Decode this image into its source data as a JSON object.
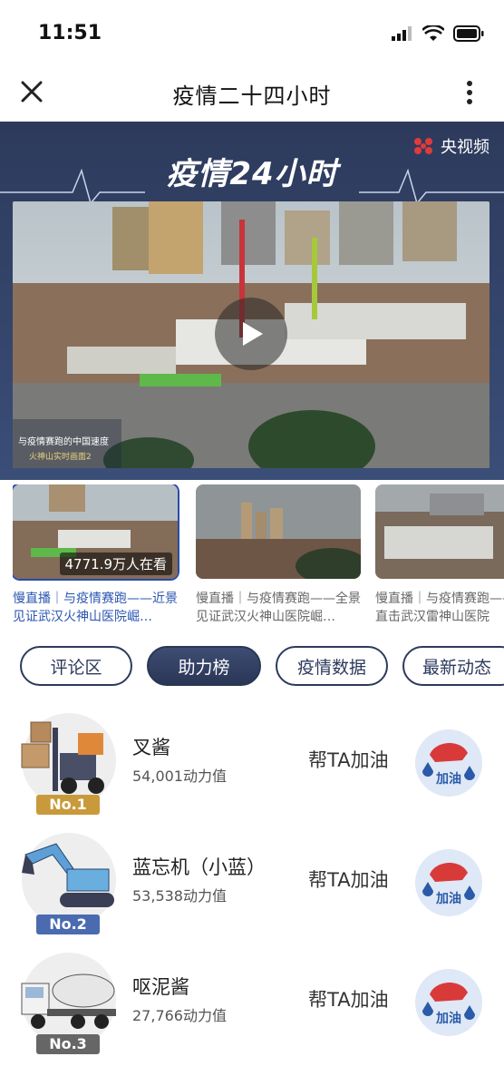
{
  "status": {
    "time": "11:51"
  },
  "nav": {
    "title": "疫情二十四小时"
  },
  "banner": {
    "logo_text": "疫情24小时",
    "brand": "央视频",
    "caption_line1": "与疫情赛跑的中国速度",
    "caption_line2": "火神山实时画面2"
  },
  "thumbs": [
    {
      "title": "慢直播｜与疫情赛跑——近景见证武汉火神山医院崛…",
      "viewers": "4771.9万人在看",
      "active": true
    },
    {
      "title": "慢直播｜与疫情赛跑——全景见证武汉火神山医院崛…",
      "active": false
    },
    {
      "title": "慢直播｜与疫情赛跑——近景直击武汉雷神山医院",
      "active": false
    }
  ],
  "tabs": [
    {
      "label": "评论区"
    },
    {
      "label": "助力榜"
    },
    {
      "label": "疫情数据"
    },
    {
      "label": "最新动态"
    }
  ],
  "ranking": [
    {
      "rank": "No.1",
      "name": "叉酱",
      "score": "54,001动力值",
      "cheer": "帮TA加油",
      "fuel": "加油",
      "rank_color": "#c99a3c"
    },
    {
      "rank": "No.2",
      "name": "蓝忘机（小蓝）",
      "score": "53,538动力值",
      "cheer": "帮TA加油",
      "fuel": "加油",
      "rank_color": "#4a6bb0"
    },
    {
      "rank": "No.3",
      "name": "呕泥酱",
      "score": "27,766动力值",
      "cheer": "帮TA加油",
      "fuel": "加油",
      "rank_color": "#666666"
    }
  ]
}
